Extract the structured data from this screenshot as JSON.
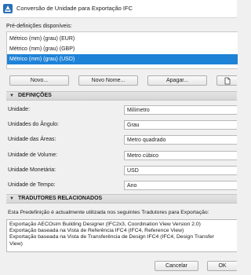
{
  "window": {
    "title": "Conversão de Unidade para Exportação IFC",
    "icon": "archicad-app-icon"
  },
  "presets": {
    "label": "Pré-definições disponíveis:",
    "items": [
      {
        "label": "Métrico (mm) (grau) (EUR)",
        "selected": false
      },
      {
        "label": "Métrico (mm) (grau) (GBP)",
        "selected": false
      },
      {
        "label": "Métrico (mm) (grau) (USD)",
        "selected": true
      }
    ]
  },
  "toolbar": {
    "new_label": "Novo...",
    "new_name_label": "Novo Nome...",
    "delete_label": "Apagar...",
    "export_icon": "export-icon"
  },
  "definitions": {
    "header": "DEFINIÇÕES",
    "rows": [
      {
        "label": "Unidade:",
        "value": "Milímetro"
      },
      {
        "label": "Unidades do Ângulo:",
        "value": "Grau"
      },
      {
        "label": "Unidade das Áreas:",
        "value": "Metro quadrado"
      },
      {
        "label": "Unidade de Volume:",
        "value": "Metro cúbico"
      },
      {
        "label": "Unidade Monetária:",
        "value": "USD"
      },
      {
        "label": "Unidade de Tempo:",
        "value": "Ano"
      }
    ]
  },
  "translators": {
    "header": "TRADUTORES RELACIONADOS",
    "description": "Esta Predefinição é actualmente utilizada nos seguintes Tradutores para Exportação:",
    "lines": [
      "Exportação AECOsim Building Designer (IFC2x3, Coordination View Version 2.0)",
      "Exportação baseada na Vista de Referência IFC4 (IFC4, Reference View)",
      "Exportação baseada na Vista de Transferência de Design IFC4 (IFC4, Design Transfer",
      "View)"
    ]
  },
  "footer": {
    "cancel_label": "Cancelar",
    "ok_label": "OK"
  },
  "colors": {
    "selection": "#1e82d7"
  }
}
